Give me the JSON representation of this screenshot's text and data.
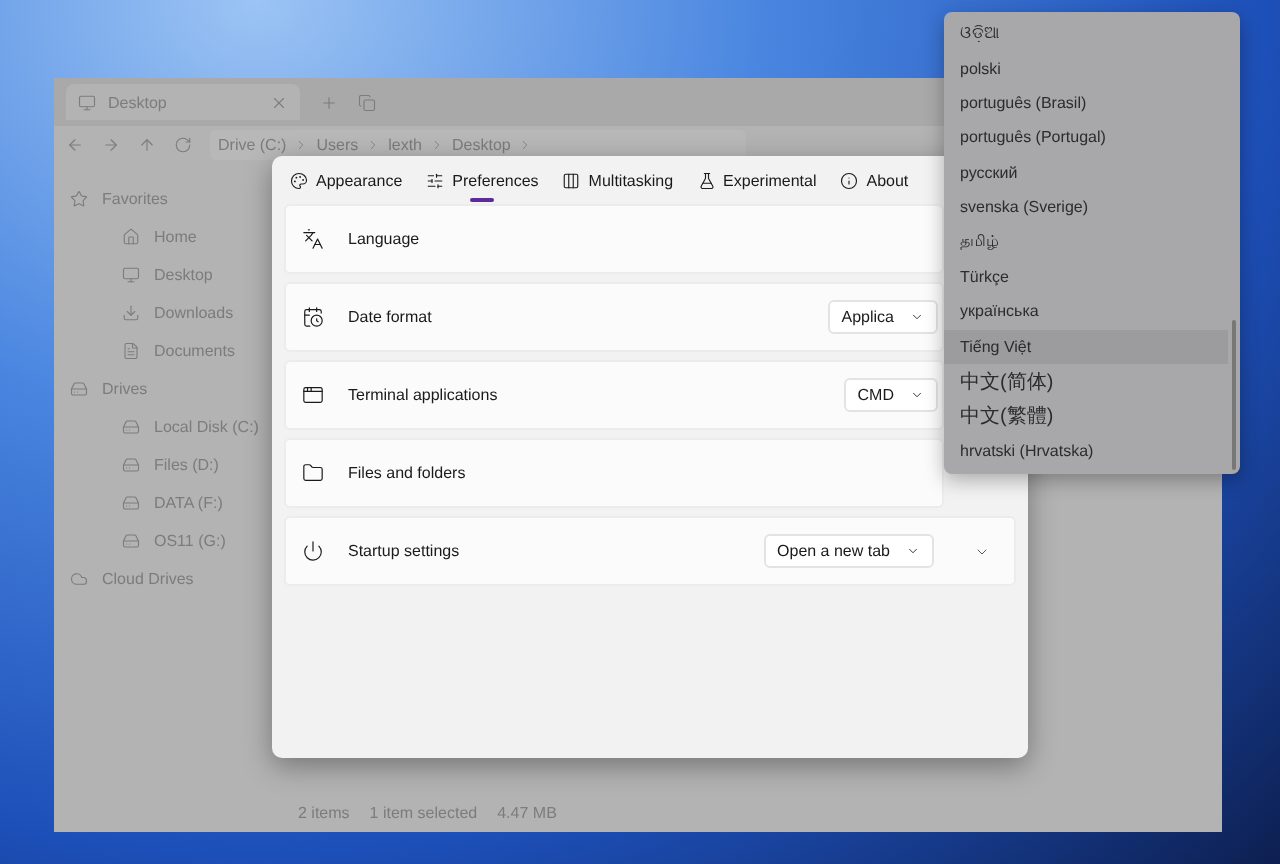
{
  "explorer": {
    "tab_title": "Desktop",
    "breadcrumb": [
      "Drive (C:)",
      "Users",
      "lexth",
      "Desktop"
    ],
    "sidebar": [
      {
        "label": "Favorites",
        "children": [
          {
            "label": "Home"
          },
          {
            "label": "Desktop"
          },
          {
            "label": "Downloads"
          },
          {
            "label": "Documents"
          }
        ]
      },
      {
        "label": "Drives",
        "children": [
          {
            "label": "Local Disk (C:)"
          },
          {
            "label": "Files (D:)"
          },
          {
            "label": "DATA (F:)"
          },
          {
            "label": "OS11 (G:)"
          }
        ]
      },
      {
        "label": "Cloud Drives"
      }
    ],
    "status_bar": [
      "2 items",
      "1 item selected",
      "4.47 MB"
    ]
  },
  "settings": {
    "tabs": [
      {
        "label": "Appearance",
        "selected": false
      },
      {
        "label": "Preferences",
        "selected": true
      },
      {
        "label": "Multitasking",
        "selected": false
      },
      {
        "label": "Experimental",
        "selected": false
      },
      {
        "label": "About",
        "selected": false
      }
    ],
    "rows": [
      {
        "label": "Language",
        "kind": "plain"
      },
      {
        "label": "Date format",
        "kind": "select",
        "value": "Applica"
      },
      {
        "label": "Terminal applications",
        "kind": "select",
        "value": "CMD"
      },
      {
        "label": "Files and folders",
        "kind": "plain"
      },
      {
        "label": "Startup settings",
        "kind": "expand",
        "value": "Open a new tab"
      }
    ]
  },
  "language_menu": {
    "items": [
      {
        "label": "ଓଡ଼ିଆ",
        "selected": false
      },
      {
        "label": "polski",
        "selected": false
      },
      {
        "label": "português (Brasil)",
        "selected": false
      },
      {
        "label": "português (Portugal)",
        "selected": false
      },
      {
        "label": "русский",
        "selected": false
      },
      {
        "label": "svenska (Sverige)",
        "selected": false
      },
      {
        "label": "தமிழ்",
        "selected": false
      },
      {
        "label": "Türkçe",
        "selected": false
      },
      {
        "label": "українська",
        "selected": false
      },
      {
        "label": "Tiếng Việt",
        "selected": true
      },
      {
        "label": "中文(简体)",
        "selected": false
      },
      {
        "label": "中文(繁體)",
        "selected": false
      },
      {
        "label": "hrvatski (Hrvatska)",
        "selected": false
      }
    ]
  }
}
